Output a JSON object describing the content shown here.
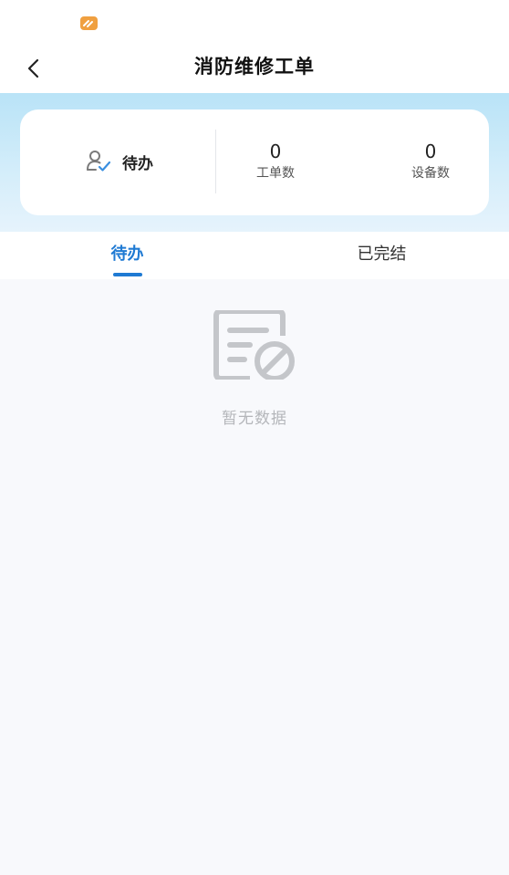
{
  "status_bar": {
    "app_icon": "app-notification-icon"
  },
  "nav": {
    "back_icon": "chevron-left-icon",
    "title": "消防维修工单"
  },
  "summary": {
    "pending_icon": "user-check-icon",
    "pending_label": "待办",
    "stats": [
      {
        "value": "0",
        "label": "工单数"
      },
      {
        "value": "0",
        "label": "设备数"
      }
    ]
  },
  "tabs": [
    {
      "label": "待办",
      "active": true
    },
    {
      "label": "已完结",
      "active": false
    }
  ],
  "empty_state": {
    "icon": "no-data-icon",
    "text": "暂无数据"
  },
  "colors": {
    "accent": "#1f7ad3",
    "empty_text": "#b4b6ba",
    "app_icon": "#f0a040"
  }
}
